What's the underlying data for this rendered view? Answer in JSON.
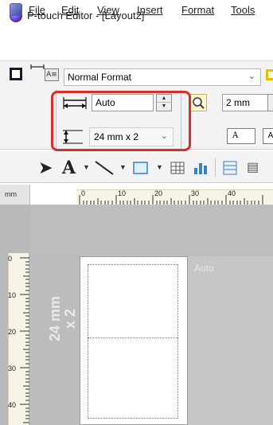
{
  "window": {
    "title": "P-touch Editor - [Layout2]"
  },
  "menu": {
    "items": [
      "File",
      "Edit",
      "View",
      "Insert",
      "Format",
      "Tools"
    ]
  },
  "toolbar": {
    "format": {
      "value": "Normal Format"
    },
    "length": {
      "value": "Auto"
    },
    "margin": {
      "value": "2 mm"
    },
    "tape": {
      "value": "24 mm x 2"
    },
    "text_button_label": "A",
    "highlight_color": "#d4302c"
  },
  "drawing_tools": [
    "select-arrow-icon",
    "text-tool-icon",
    "line-tool-icon",
    "rectangle-tool-icon",
    "table-tool-icon",
    "chart-tool-icon",
    "database-tool-icon"
  ],
  "ruler": {
    "unit": "mm",
    "h_ticks": [
      "0",
      "10",
      "20",
      "30",
      "40"
    ],
    "v_ticks": [
      "0",
      "10",
      "20",
      "30",
      "40"
    ]
  },
  "canvas": {
    "auto_label": "Auto",
    "tape_size_label": "24 mm\nx 2"
  }
}
